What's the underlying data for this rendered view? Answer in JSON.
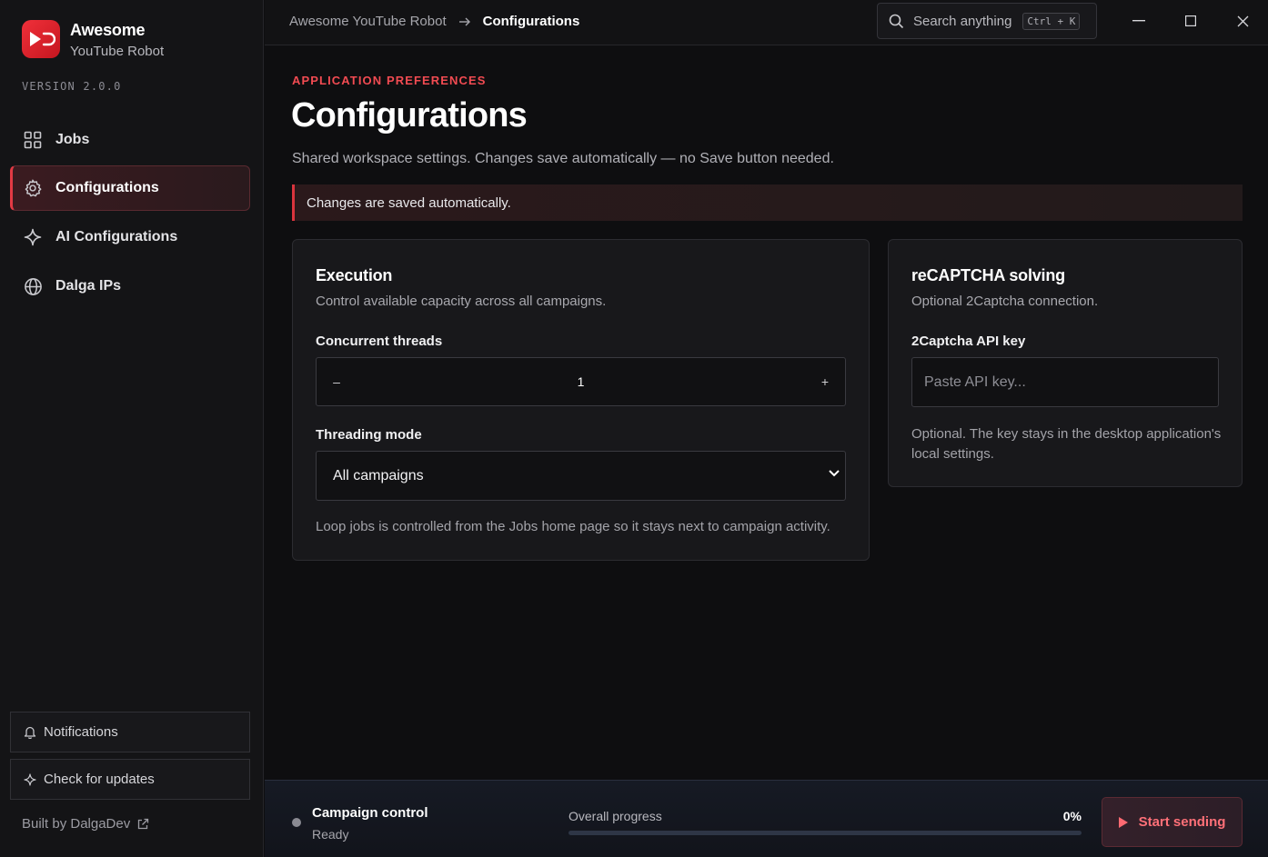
{
  "app": {
    "brand_name": "Awesome",
    "brand_sub": "YouTube Robot",
    "version": "VERSION 2.0.0",
    "accent_color": "#e23a44"
  },
  "sidebar": {
    "items": [
      {
        "label": "Jobs",
        "icon": "grid-icon",
        "active": false
      },
      {
        "label": "Configurations",
        "icon": "gear-icon",
        "active": true
      },
      {
        "label": "AI Configurations",
        "icon": "sparkle-icon",
        "active": false
      },
      {
        "label": "Dalga IPs",
        "icon": "globe-icon",
        "active": false
      }
    ],
    "notifications_label": "Notifications",
    "updates_label": "Check for updates",
    "built_by": "Built by DalgaDev"
  },
  "topbar": {
    "breadcrumb_root": "Awesome YouTube Robot",
    "breadcrumb_current": "Configurations",
    "search_placeholder": "Search anything",
    "search_shortcut": "Ctrl + K"
  },
  "main": {
    "eyebrow": "APPLICATION PREFERENCES",
    "title": "Configurations",
    "description": "Shared workspace settings. Changes save automatically — no Save button needed.",
    "banner": "Changes are saved automatically."
  },
  "execution": {
    "title": "Execution",
    "description": "Control available capacity across all campaigns.",
    "threads_label": "Concurrent threads",
    "threads_minus": "–",
    "threads_value": "1",
    "threads_plus": "+",
    "mode_label": "Threading mode",
    "mode_value": "All campaigns",
    "helper": "Loop jobs is controlled from the Jobs home page so it stays next to campaign activity."
  },
  "recaptcha": {
    "title": "reCAPTCHA solving",
    "description": "Optional 2Captcha connection.",
    "key_label": "2Captcha API key",
    "key_placeholder": "Paste API key...",
    "helper": "Optional. The key stays in the desktop application's local settings."
  },
  "campaign": {
    "title": "Campaign control",
    "status": "Ready",
    "progress_label": "Overall progress",
    "progress_pct": "0%",
    "progress_value": 0,
    "start_label": "Start sending"
  }
}
